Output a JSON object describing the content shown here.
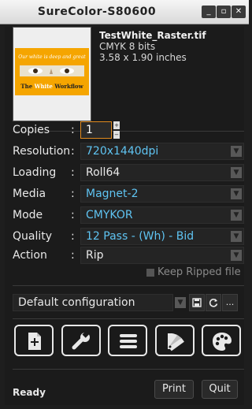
{
  "window": {
    "title": "SureColor-S80600"
  },
  "file": {
    "name": "TestWhite_Raster.tif",
    "color": "CMYK 8 bits",
    "size": "3.58 x 1.90 inches",
    "thumbnail": {
      "top_text": "Our white is deep and great",
      "bottom_text_1": "The ",
      "bottom_text_2": "White",
      "bottom_text_3": " Workflow"
    }
  },
  "settings": {
    "copies": {
      "label": "Copies",
      "value": "1"
    },
    "resolution": {
      "label": "Resolution",
      "value": "720x1440dpi"
    },
    "loading": {
      "label": "Loading",
      "value": "Roll64"
    },
    "media": {
      "label": "Media",
      "value": "Magnet-2"
    },
    "mode": {
      "label": "Mode",
      "value": "CMYKOR"
    },
    "quality": {
      "label": "Quality",
      "value": "12 Pass - (Wh) - Bid"
    },
    "action": {
      "label": "Action",
      "value": "Rip"
    },
    "separator": ":"
  },
  "keep_ripped": {
    "label": "Keep Ripped file",
    "checked": false
  },
  "configuration": {
    "value": "Default configuration",
    "more_label": "..."
  },
  "tools": [
    {
      "icon": "add-page-icon"
    },
    {
      "icon": "wrench-icon"
    },
    {
      "icon": "list-icon"
    },
    {
      "icon": "color-swatch-icon"
    },
    {
      "icon": "palette-icon"
    }
  ],
  "status": {
    "text": "Ready"
  },
  "actions": {
    "print_label": "Print",
    "quit_label": "Quit"
  },
  "colors": {
    "accent_value": "#5fc4f2",
    "focus_border": "#e08a1e",
    "background": "#1e1e1e"
  }
}
